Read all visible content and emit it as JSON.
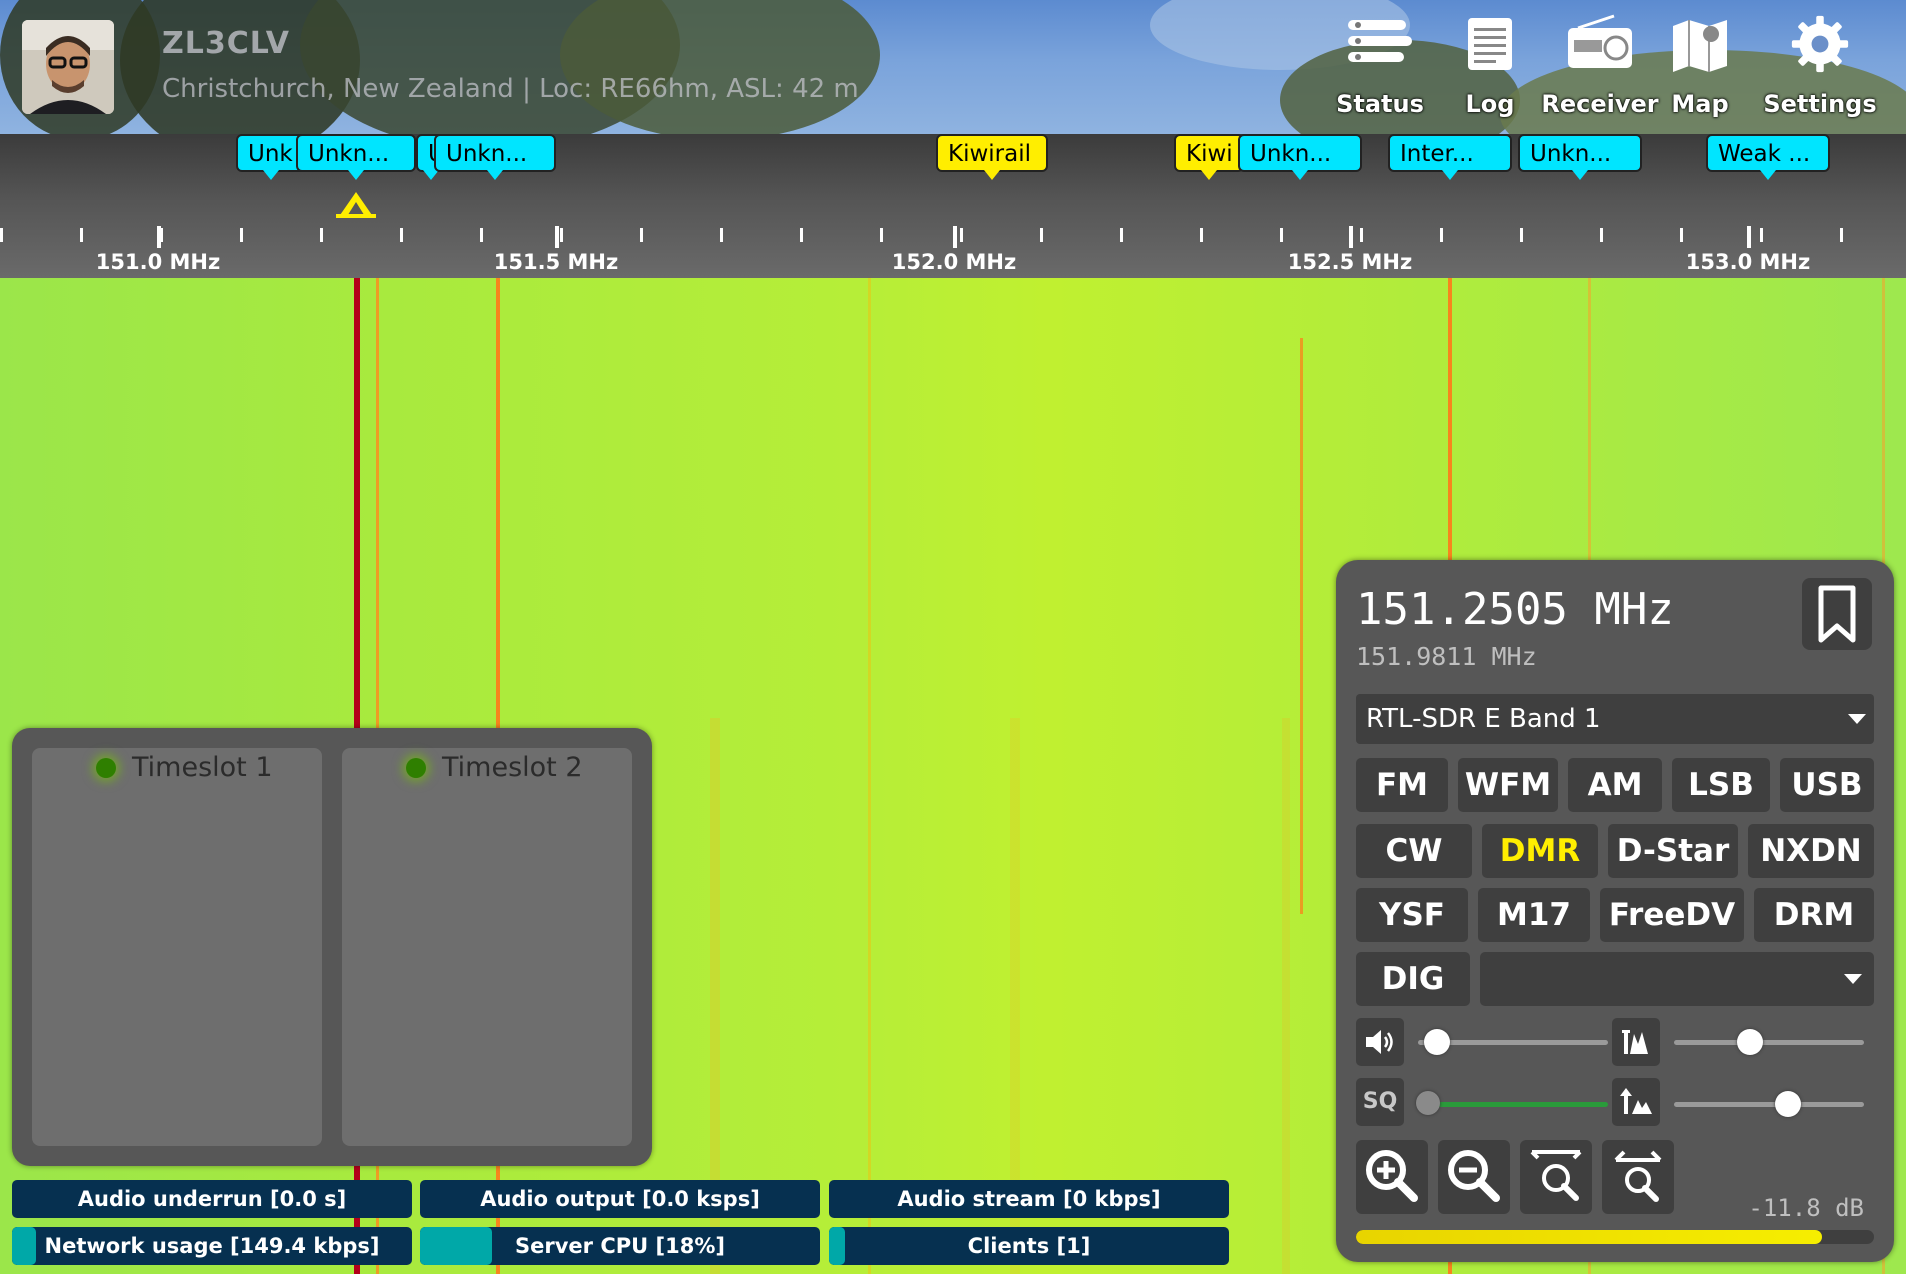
{
  "header": {
    "callsign": "ZL3CLV",
    "location": "Christchurch, New Zealand | Loc: RE66hm, ASL: 42 m",
    "buttons": [
      {
        "label": "Status",
        "icon": "status-icon"
      },
      {
        "label": "Log",
        "icon": "log-icon"
      },
      {
        "label": "Receiver",
        "icon": "radio-icon"
      },
      {
        "label": "Map",
        "icon": "map-icon"
      },
      {
        "label": "Settings",
        "icon": "gear-icon"
      }
    ]
  },
  "bookmarks": [
    {
      "label": "Unk",
      "color": "cyan"
    },
    {
      "label": "Unkn...",
      "color": "cyan"
    },
    {
      "label": "U",
      "color": "cyan"
    },
    {
      "label": "Unkn...",
      "color": "cyan"
    },
    {
      "label": "Kiwirail",
      "color": "yellow"
    },
    {
      "label": "Kiwi",
      "color": "yellow"
    },
    {
      "label": "Unkn...",
      "color": "cyan"
    },
    {
      "label": "Inter...",
      "color": "cyan"
    },
    {
      "label": "Unkn...",
      "color": "cyan"
    },
    {
      "label": "Weak ...",
      "color": "cyan"
    }
  ],
  "scale": {
    "labels": [
      "151.0 MHz",
      "151.5 MHz",
      "152.0 MHz",
      "152.5 MHz",
      "153.0 MHz"
    ]
  },
  "dmr": {
    "slot1": "Timeslot 1",
    "slot2": "Timeslot 2"
  },
  "status_bars": [
    {
      "label": "Audio underrun [0.0 s]",
      "fill": 0
    },
    {
      "label": "Audio output [0.0 ksps]",
      "fill": 0
    },
    {
      "label": "Audio stream [0 kbps]",
      "fill": 0
    },
    {
      "label": "Network usage [149.4 kbps]",
      "fill": 0.06
    },
    {
      "label": "Server CPU [18%]",
      "fill": 0.18
    },
    {
      "label": "Clients [1]",
      "fill": 0.04
    }
  ],
  "receiver": {
    "frequency": "151.2505 MHz",
    "center_frequency": "151.9811 MHz",
    "profile": "RTL-SDR E Band 1",
    "modes_row1": [
      "FM",
      "WFM",
      "AM",
      "LSB",
      "USB"
    ],
    "modes_row2": [
      "CW",
      "DMR",
      "D-Star",
      "NXDN"
    ],
    "modes_row3": [
      "YSF",
      "M17",
      "FreeDV",
      "DRM"
    ],
    "dig_label": "DIG",
    "active_mode": "DMR",
    "squelch_label": "SQ",
    "volume_level": 0.1,
    "waterfall_level": 0.4,
    "squelch_level": 0.05,
    "zoom_level": 0.6,
    "signal_db": "-11.8 dB",
    "signal_level": 0.9
  },
  "colors": {
    "bookmark_cyan": "#00e5ff",
    "bookmark_yellow": "#ffee00",
    "active_mode": "#ffee00",
    "status_bar_bg": "#063050",
    "status_bar_fill": "#00a8a8"
  }
}
